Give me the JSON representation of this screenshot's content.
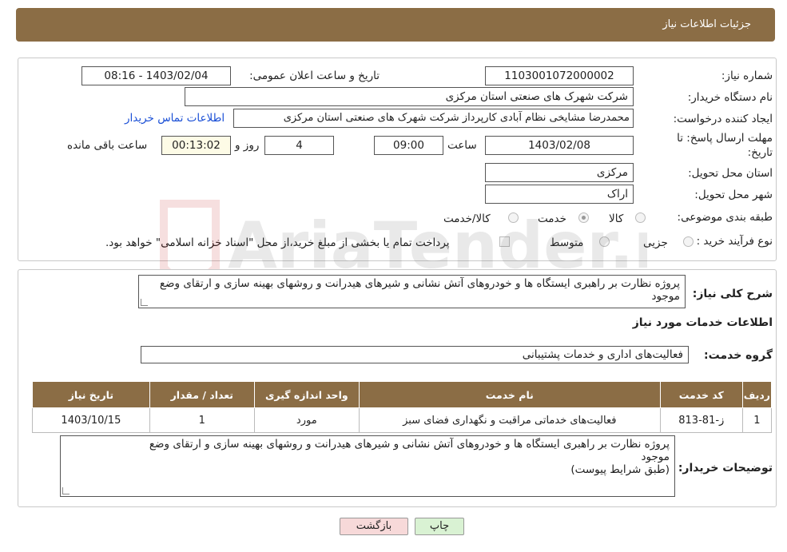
{
  "header": {
    "title": "جزئیات اطلاعات نیاز"
  },
  "form": {
    "need_number_label": "شماره نیاز:",
    "need_number": "1103001072000002",
    "announce_label": "تاریخ و ساعت اعلان عمومی:",
    "announce_value": "1403/02/04 - 08:16",
    "buyer_org_label": "نام دستگاه خریدار:",
    "buyer_org": "شرکت شهرک های صنعتی استان مرکزی",
    "creator_label": "ایجاد کننده درخواست:",
    "creator": "محمدرضا مشایخی نظام آبادی کارپرداز شرکت شهرک های صنعتی استان مرکزی",
    "contact_link": "اطلاعات تماس خریدار",
    "deadline_label_1": "مهلت ارسال پاسخ: تا",
    "deadline_label_2": "تاریخ:",
    "deadline_date": "1403/02/08",
    "time_label": "ساعت",
    "deadline_time": "09:00",
    "days_value": "4",
    "days_label": "روز و",
    "remaining_time": "00:13:02",
    "remaining_label": "ساعت باقی مانده",
    "province_label": "استان محل تحویل:",
    "province": "مرکزی",
    "city_label": "شهر محل تحویل:",
    "city": "اراک",
    "category_label": "طبقه بندی موضوعی:",
    "category_options": [
      "کالا",
      "خدمت",
      "کالا/خدمت"
    ],
    "category_selected": "خدمت",
    "purchase_type_label": "نوع فرآیند خرید :",
    "purchase_options": [
      "جزیی",
      "متوسط"
    ],
    "payment_note": "پرداخت تمام یا بخشی از مبلغ خرید،از محل \"اسناد خزانه اسلامی\" خواهد بود."
  },
  "summary": {
    "label": "شرح کلی نیاز:",
    "text": "پروژه نظارت بر راهبری ایستگاه ها و خودروهای آتش نشانی و شیرهای هیدرانت و روشهای بهینه سازی و ارتقای وضع موجود"
  },
  "services": {
    "section_title": "اطلاعات خدمات مورد نیاز",
    "group_label": "گروه خدمت:",
    "group_value": "فعالیت‌های اداری و خدمات پشتیبانی",
    "columns": [
      "ردیف",
      "کد خدمت",
      "نام خدمت",
      "واحد اندازه گیری",
      "تعداد / مقدار",
      "تاریخ نیاز"
    ],
    "rows": [
      [
        "1",
        "ز-81-813",
        "فعالیت‌های خدماتی مراقبت و نگهداری فضای سبز",
        "مورد",
        "1",
        "1403/10/15"
      ]
    ]
  },
  "buyer_notes": {
    "label": "توضیحات خریدار:",
    "line1": "پروژه نظارت بر راهبری ایستگاه ها و خودروهای آتش نشانی و شیرهای هیدرانت و روشهای بهینه سازی و ارتقای وضع",
    "line2": "موجود",
    "line3": "(طبق شرایط پیوست)"
  },
  "buttons": {
    "print": "چاپ",
    "back": "بازگشت"
  },
  "watermark": "AriaTender.neT",
  "colors": {
    "header": "#8b6d45",
    "link": "#1a4fd6",
    "back_button": "#f7d9d9",
    "print_button": "#d9f2d3"
  }
}
